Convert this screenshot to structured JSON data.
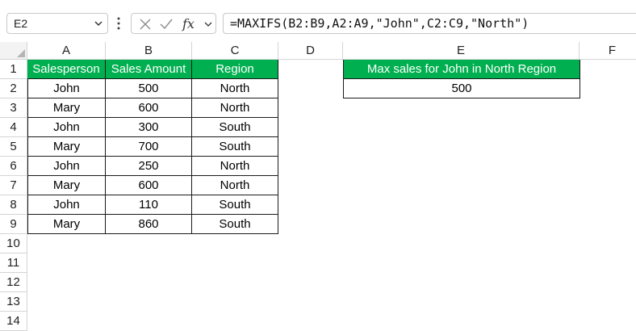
{
  "name_box": "E2",
  "formula": "=MAXIFS(B2:B9,A2:A9,\"John\",C2:C9,\"North\")",
  "icons": {
    "cancel": "x-icon",
    "enter": "check-icon",
    "function": "fx-icon"
  },
  "fx_label": "fx",
  "colors": {
    "header_fill": "#00b050",
    "header_text": "#ffffff"
  },
  "columns": [
    "A",
    "B",
    "C",
    "D",
    "E",
    "F"
  ],
  "rows": [
    "1",
    "2",
    "3",
    "4",
    "5",
    "6",
    "7",
    "8",
    "9",
    "10",
    "11",
    "12",
    "13",
    "14"
  ],
  "table": {
    "headers": [
      "Salesperson",
      "Sales Amount",
      "Region"
    ],
    "rows": [
      [
        "John",
        "500",
        "North"
      ],
      [
        "Mary",
        "600",
        "North"
      ],
      [
        "John",
        "300",
        "South"
      ],
      [
        "Mary",
        "700",
        "South"
      ],
      [
        "John",
        "250",
        "North"
      ],
      [
        "Mary",
        "600",
        "North"
      ],
      [
        "John",
        "110",
        "South"
      ],
      [
        "Mary",
        "860",
        "South"
      ]
    ]
  },
  "result": {
    "label": "Max sales for John in North Region",
    "value": "500"
  }
}
